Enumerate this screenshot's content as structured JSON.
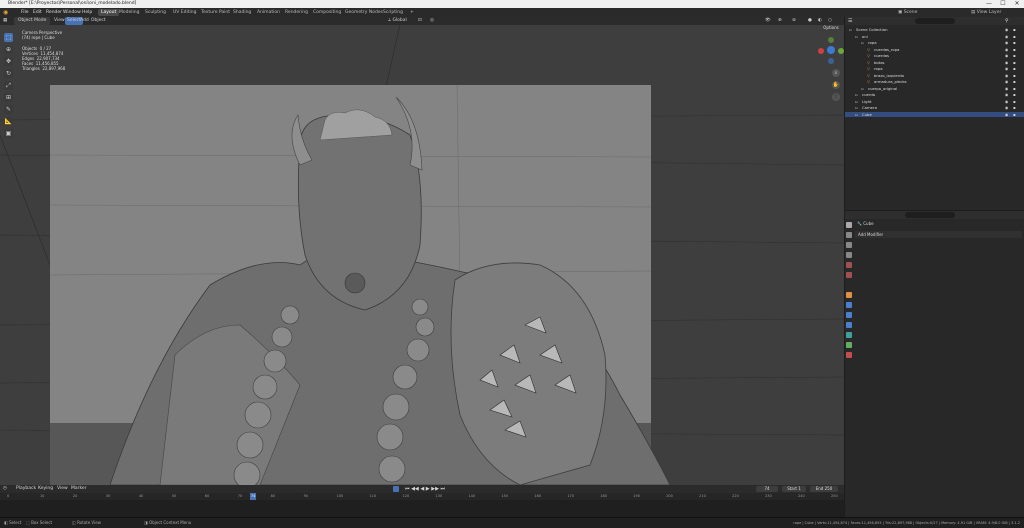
{
  "window": {
    "title": "Blender* [E:\\Proyectos\\Personal\\oni\\oni_modelado.blend]",
    "min": "—",
    "max": "☐",
    "close": "✕"
  },
  "menus": [
    "File",
    "Edit",
    "Render",
    "Window",
    "Help"
  ],
  "workspaces": [
    "Layout",
    "Modeling",
    "Sculpting",
    "UV Editing",
    "Texture Paint",
    "Shading",
    "Animation",
    "Rendering",
    "Compositing",
    "Geometry Nodes",
    "Scripting"
  ],
  "active_workspace": "Layout",
  "scene": {
    "label": "Scene",
    "view_layer": "View Layer"
  },
  "viewport_header": {
    "mode": "Object Mode",
    "menus": [
      "View",
      "Select",
      "Add",
      "Object"
    ],
    "transform": "Global",
    "options": "Options"
  },
  "overlay_stats": {
    "title": "Camera Perspective",
    "subtitle": "(74) rope | Cube",
    "rows": [
      {
        "k": "Objects",
        "v": "0 / 27"
      },
      {
        "k": "Vertices",
        "v": "11,454,874"
      },
      {
        "k": "Edges",
        "v": "22,907,734"
      },
      {
        "k": "Faces",
        "v": "11,456,855"
      },
      {
        "k": "Triangles",
        "v": "22,897,968"
      }
    ]
  },
  "outliner": {
    "header": "Scene Collection",
    "rows": [
      {
        "label": "Scene Collection",
        "depth": 0
      },
      {
        "label": "oni",
        "depth": 1
      },
      {
        "label": "ropa",
        "depth": 2
      },
      {
        "label": "cuerdas_ropa",
        "depth": 3
      },
      {
        "label": "cuerdas",
        "depth": 3
      },
      {
        "label": "botas",
        "depth": 3
      },
      {
        "label": "ropa",
        "depth": 3
      },
      {
        "label": "brazo_izquierdo",
        "depth": 3
      },
      {
        "label": "armadura_piedra",
        "depth": 3
      },
      {
        "label": "cuerpo_original",
        "depth": 2
      },
      {
        "label": "cuerda",
        "depth": 1
      },
      {
        "label": "Light",
        "depth": 1
      },
      {
        "label": "Camera",
        "depth": 1
      },
      {
        "label": "Cube",
        "depth": 1,
        "selected": true
      }
    ]
  },
  "properties": {
    "object_name": "Cube",
    "panel": "Add Modifier"
  },
  "timeline": {
    "menus": [
      "Playback",
      "Keying",
      "View",
      "Marker"
    ],
    "current_frame": "74",
    "start_label": "Start",
    "start": "1",
    "end_label": "End",
    "end": "250",
    "ticks": [
      "0",
      "10",
      "20",
      "30",
      "40",
      "50",
      "60",
      "70",
      "80",
      "90",
      "100",
      "110",
      "120",
      "130",
      "140",
      "150",
      "160",
      "170",
      "180",
      "190",
      "200",
      "210",
      "220",
      "230",
      "240",
      "250"
    ]
  },
  "status": {
    "select": "Select",
    "box_select": "Box Select",
    "rotate_view": "Rotate View",
    "context_menu": "Object Context Menu",
    "stats": "rope | Cube | Verts:11,454,874 | Faces:11,456,855 | Tris:22,897,968 | Objects:0/27 | Memory: 4.91 GiB | VRAM: 4.9/8.0 GiB | 3.1.2"
  }
}
